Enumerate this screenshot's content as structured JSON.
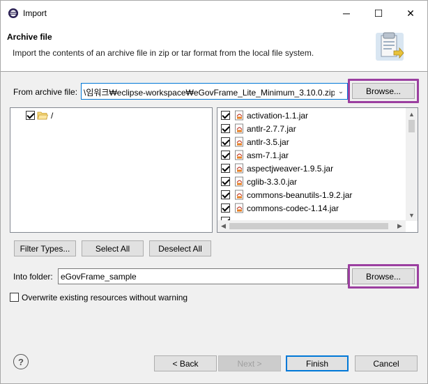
{
  "window": {
    "title": "Import",
    "minimize_glyph": "─",
    "maximize_glyph": "☐",
    "close_glyph": "✕"
  },
  "header": {
    "title": "Archive file",
    "description": "Import the contents of an archive file in zip or tar format from the local file system."
  },
  "from_archive": {
    "label": "From archive file:",
    "value": "\\임워크₩eclipse-workspace₩eGovFrame_Lite_Minimum_3.10.0.zip",
    "browse_label": "Browse..."
  },
  "tree": {
    "items": [
      {
        "label": "/",
        "checked": true
      }
    ]
  },
  "file_list": {
    "items": [
      {
        "label": "activation-1.1.jar",
        "checked": true
      },
      {
        "label": "antlr-2.7.7.jar",
        "checked": true
      },
      {
        "label": "antlr-3.5.jar",
        "checked": true
      },
      {
        "label": "asm-7.1.jar",
        "checked": true
      },
      {
        "label": "aspectjweaver-1.9.5.jar",
        "checked": true
      },
      {
        "label": "cglib-3.3.0.jar",
        "checked": true
      },
      {
        "label": "commons-beanutils-1.9.2.jar",
        "checked": true
      },
      {
        "label": "commons-codec-1.14.jar",
        "checked": true
      }
    ]
  },
  "selection_buttons": {
    "filter_types": "Filter Types...",
    "select_all": "Select All",
    "deselect_all": "Deselect All"
  },
  "into_folder": {
    "label": "Into folder:",
    "value": "eGovFrame_sample",
    "browse_label": "Browse..."
  },
  "overwrite": {
    "label": "Overwrite existing resources without warning",
    "checked": false
  },
  "footer": {
    "help_glyph": "?",
    "back_label": "< Back",
    "next_label": "Next >",
    "finish_label": "Finish",
    "cancel_label": "Cancel"
  },
  "colors": {
    "highlight": "#9b3fa0",
    "focus": "#0078d7"
  }
}
